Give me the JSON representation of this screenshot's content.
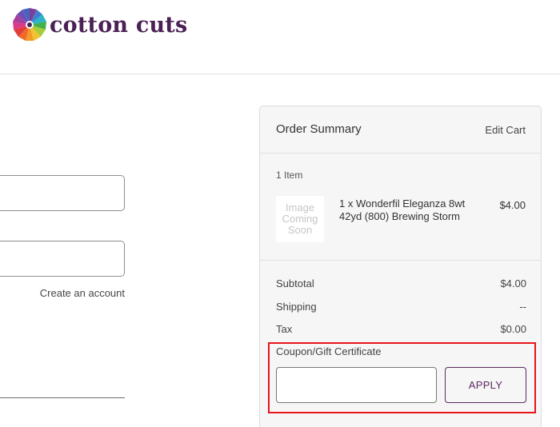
{
  "brand": {
    "logo_text": "cotton cuts",
    "logo_icon": "quilt-flower-icon"
  },
  "checkout_form": {
    "create_account_link": "Create an account"
  },
  "order_summary": {
    "title": "Order Summary",
    "edit_cart_label": "Edit Cart",
    "items_count": "1 Item",
    "item": {
      "image_placeholder": [
        "Image",
        "Coming",
        "Soon"
      ],
      "name": "1 x Wonderfil Eleganza 8wt 42yd (800) Brewing Storm",
      "price": "$4.00"
    },
    "totals": [
      {
        "label": "Subtotal",
        "value": "$4.00"
      },
      {
        "label": "Shipping",
        "value": "--"
      },
      {
        "label": "Tax",
        "value": "$0.00"
      }
    ],
    "coupon": {
      "label": "Coupon/Gift Certificate",
      "value": "",
      "apply_label": "APPLY"
    }
  },
  "colors": {
    "brand": "#4b2155",
    "highlight": "#e8141b",
    "panel_bg": "#f6f6f6"
  }
}
